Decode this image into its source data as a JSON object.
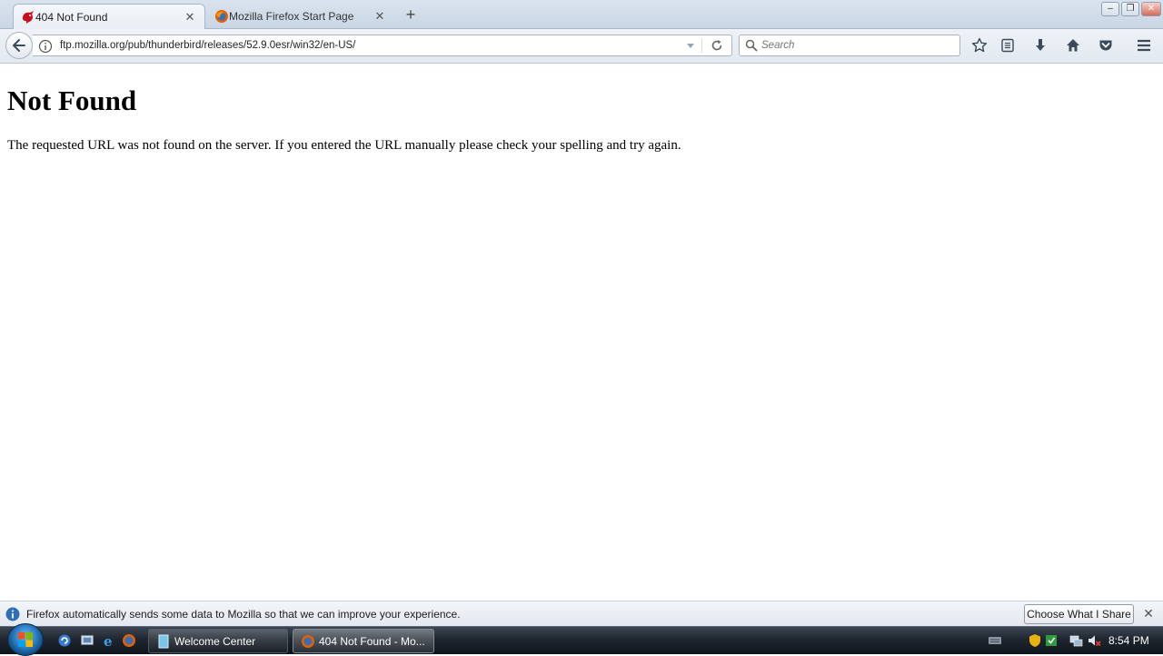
{
  "tabs": [
    {
      "label": "404 Not Found",
      "active": true,
      "icon": "thunderbird-icon"
    },
    {
      "label": "Mozilla Firefox Start Page",
      "active": false,
      "icon": "firefox-icon"
    }
  ],
  "window_controls": {
    "minimize": "–",
    "restore": "❐",
    "close": "✕"
  },
  "tab_close_glyph": "✕",
  "new_tab_glyph": "+",
  "navbar": {
    "url": "ftp.mozilla.org/pub/thunderbird/releases/52.9.0esr/win32/en-US/",
    "search_placeholder": "Search"
  },
  "page": {
    "heading": "Not Found",
    "message": "The requested URL was not found on the server. If you entered the URL manually please check your spelling and try again."
  },
  "notification": {
    "message": "Firefox automatically sends some data to Mozilla so that we can improve your experience.",
    "button_label": "Choose What I Share",
    "close_glyph": "✕"
  },
  "taskbar": {
    "buttons": [
      {
        "label": "Welcome Center",
        "active": false
      },
      {
        "label": "404 Not Found - Mo...",
        "active": true
      }
    ],
    "clock": "8:54 PM"
  },
  "colors": {
    "accent": "#2a7bc0",
    "tab_bg": "#d9e3ee",
    "taskbar": "#1f2630"
  }
}
